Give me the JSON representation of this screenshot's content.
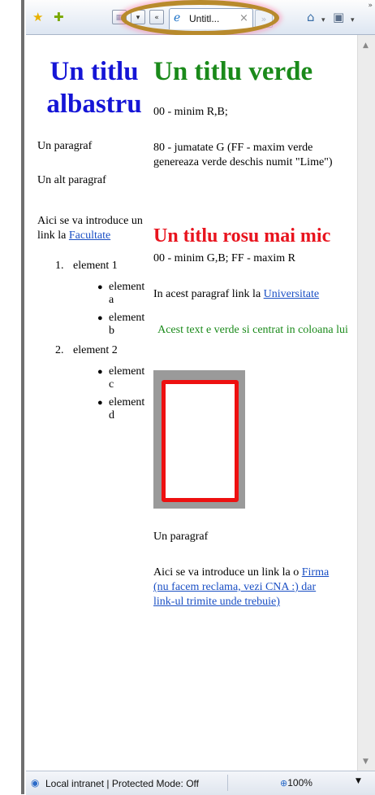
{
  "toolbar": {
    "icons": [
      "favorites-star-icon",
      "add-favorites-icon",
      "quick-tabs-icon",
      "tab-list-icon",
      "tab-scroll-left-icon",
      "home-icon",
      "feeds-icon"
    ],
    "tab_title": "Untitl...",
    "tab_close": "×",
    "new_tab": "»",
    "overflow": "»",
    "highlight_color": "#b88a2c"
  },
  "page": {
    "title_blue": "Un titlu albastru",
    "title_green": "Un titlu verde",
    "left_para1": "Un paragraf",
    "left_para2": "Un alt paragraf",
    "left_link_intro": "Aici se va introduce un link la",
    "left_link": "Facultate",
    "list": {
      "item1": "element 1",
      "item1_sub": [
        "element a",
        "element b"
      ],
      "item2": "element 2",
      "item2_sub": [
        "element c",
        "element d"
      ],
      "num1": "1.",
      "num2": "2."
    },
    "right_p1": "00 - minim R,B;",
    "right_p2": "80 - jumatate G (FF - maxim verde genereaza verde deschis numit \"Lime\")",
    "title_red": "Un titlu rosu mai mic",
    "right_p3": "00 - minim G,B; FF - maxim R",
    "right_link_intro": "In acest paragraf link la",
    "right_link": "Universitate",
    "centered_green": "Acest text e verde si centrat in coloana lui",
    "right_p4": "Un paragraf",
    "right_link2_intro": "Aici se va introduce un link la o",
    "right_link2": "Firma (nu facem reclama, vezi CNA :) dar link-ul trimite unde trebuie)",
    "colors": {
      "blue_title": "#1515d6",
      "green_title": "#1a8a1a",
      "red_title": "#e8141e",
      "link": "#1a4fc4",
      "box_border": "#ee1010",
      "box_bg": "#9a9a9a"
    }
  },
  "statusbar": {
    "zone": "Local intranet | Protected Mode: Off",
    "zoom": "100%",
    "zoom_icon": "zoom-icon"
  }
}
